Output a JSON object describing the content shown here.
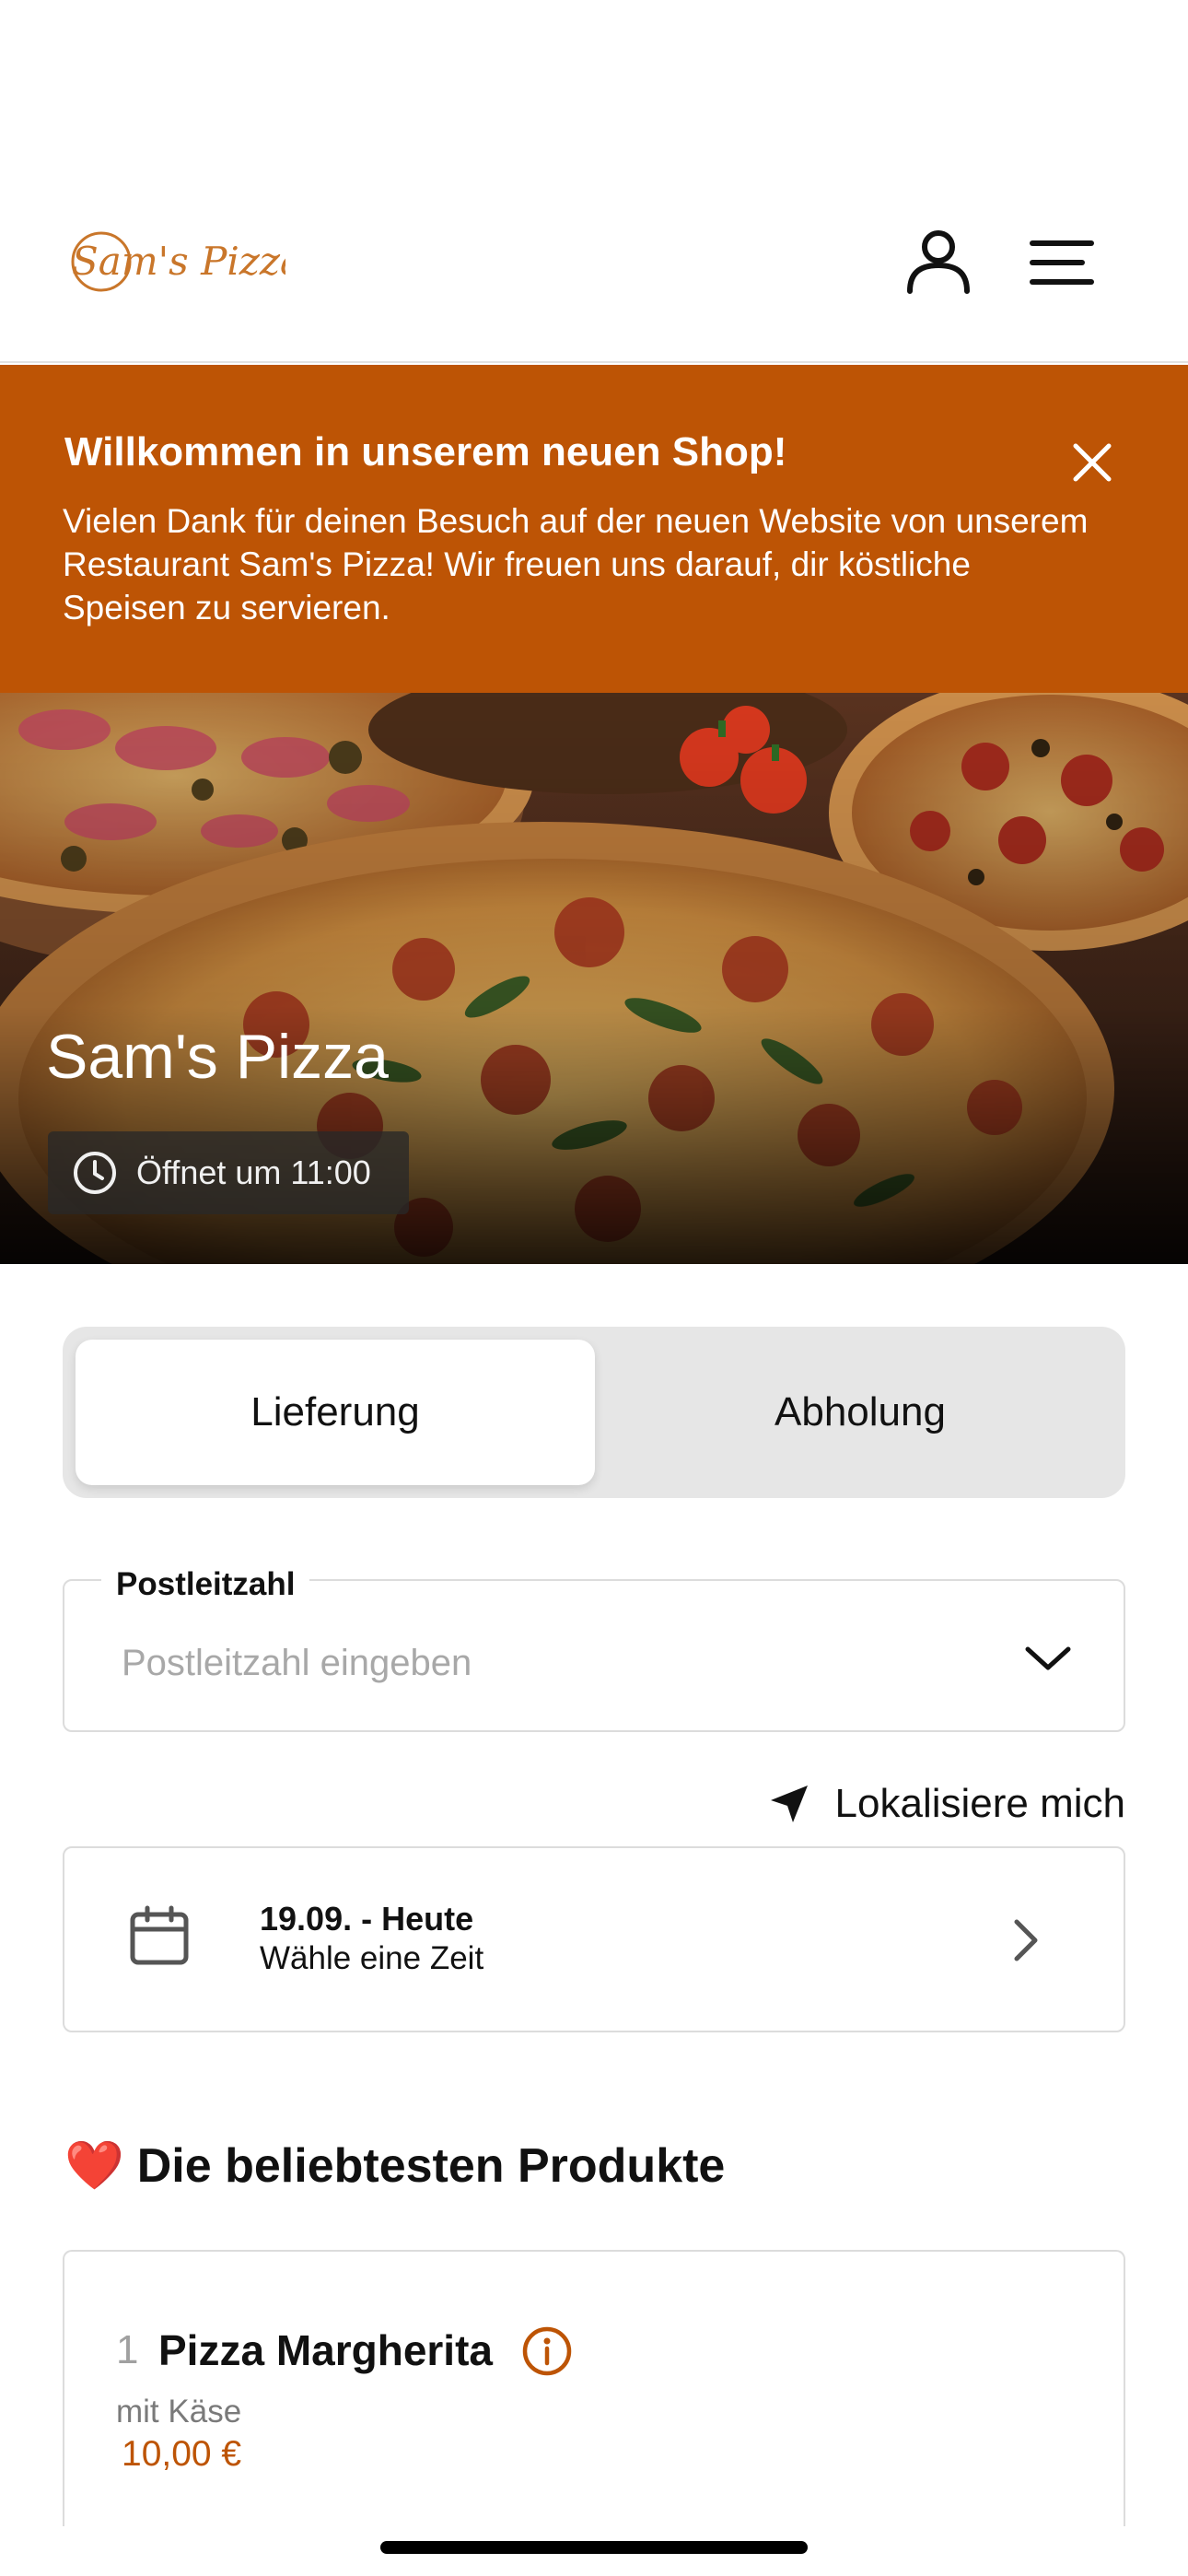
{
  "colors": {
    "accent": "#bd5405",
    "text": "#111111",
    "muted": "#a8a8a8",
    "border": "#dcdcdc",
    "segment_bg": "#e6e6e6"
  },
  "header": {
    "logo_text": "Sam's Pizza",
    "account_icon": "user-icon",
    "menu_icon": "hamburger-menu-icon"
  },
  "banner": {
    "title": "Willkommen in unserem neuen Shop!",
    "text": "Vielen Dank für deinen Besuch auf der neuen Website von unserem Restaurant Sam's Pizza! Wir freuen uns darauf, dir köstliche Speisen zu servieren.",
    "close_icon": "close-icon"
  },
  "hero": {
    "title": "Sam's Pizza",
    "hours_icon": "clock-icon",
    "hours": "Öffnet um 11:00"
  },
  "order_mode": {
    "options": [
      "Lieferung",
      "Abholung"
    ],
    "selected": "Lieferung"
  },
  "zip": {
    "label": "Postleitzahl",
    "placeholder": "Postleitzahl eingeben",
    "value": "",
    "icon": "chevron-down-icon"
  },
  "locate": {
    "icon": "location-arrow-icon",
    "label": "Lokalisiere mich"
  },
  "date_picker": {
    "icon": "calendar-icon",
    "date": "19.09. - Heute",
    "hint": "Wähle eine Zeit",
    "chevron": "chevron-right-icon"
  },
  "popular": {
    "emoji": "❤️",
    "title": "Die beliebtesten Produkte",
    "products": [
      {
        "number": "1",
        "name": "Pizza Margherita",
        "description": "mit Käse",
        "price": "10,00 €",
        "info_icon": "info-icon"
      }
    ]
  }
}
